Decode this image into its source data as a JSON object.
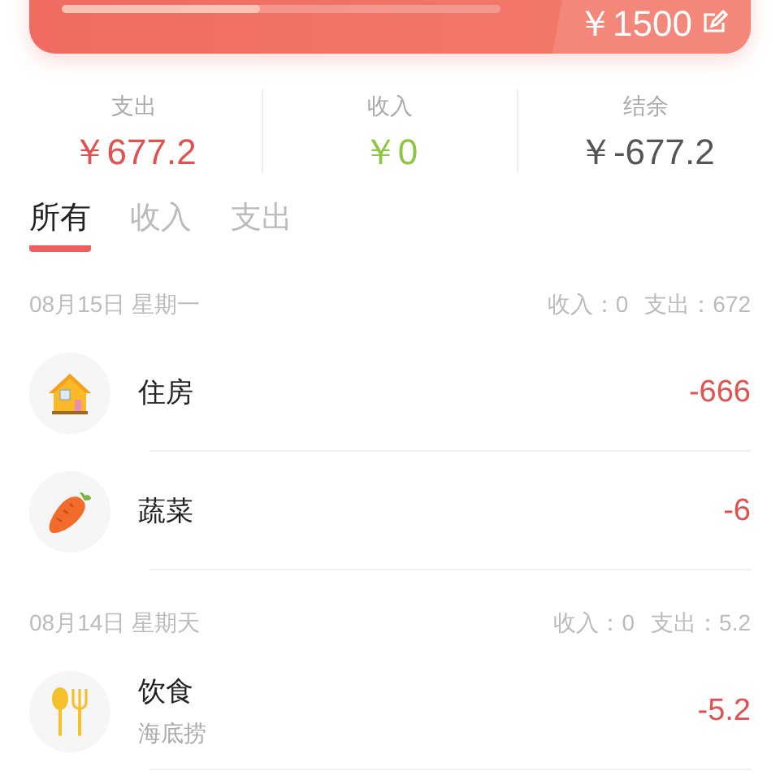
{
  "budget": {
    "level": 0.45,
    "amount": "￥1500"
  },
  "summary": [
    {
      "label": "支出",
      "value": "￥677.2",
      "kind": "expense"
    },
    {
      "label": "收入",
      "value": "￥0",
      "kind": "income"
    },
    {
      "label": "结余",
      "value": "￥-677.2",
      "kind": "balance"
    }
  ],
  "tabs": [
    {
      "label": "所有",
      "selected": true
    },
    {
      "label": "收入",
      "selected": false
    },
    {
      "label": "支出",
      "selected": false
    }
  ],
  "days": [
    {
      "date": "08月15日 星期一",
      "income": "收入：0",
      "expense": "支出：672",
      "entries": [
        {
          "kind": "housing",
          "category": "住房",
          "amount": "-666"
        },
        {
          "kind": "vegetables",
          "category": "蔬菜",
          "amount": "-6"
        }
      ]
    },
    {
      "date": "08月14日 星期天",
      "income": "收入：0",
      "expense": "支出：5.2",
      "entries": [
        {
          "kind": "food",
          "category": "饮食",
          "note": "海底捞",
          "amount": "-5.2"
        }
      ]
    }
  ]
}
